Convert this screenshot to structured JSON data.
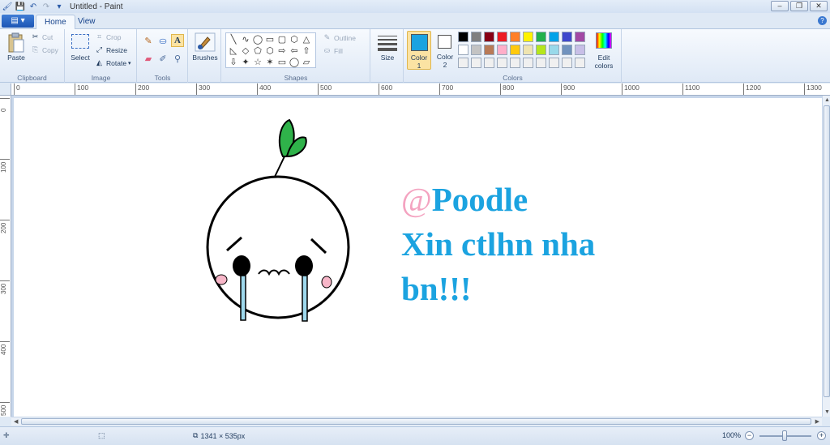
{
  "window": {
    "title": "Untitled - Paint",
    "minimize_label": "–",
    "restore_label": "❐",
    "close_label": "✕"
  },
  "tabs": {
    "file_label": "▤ ▾",
    "home": "Home",
    "view": "View",
    "help": "?"
  },
  "clipboard": {
    "group_label": "Clipboard",
    "paste": "Paste",
    "cut": "Cut",
    "copy": "Copy"
  },
  "image": {
    "group_label": "Image",
    "select": "Select",
    "crop": "Crop",
    "resize": "Resize",
    "rotate": "Rotate"
  },
  "tools": {
    "group_label": "Tools"
  },
  "brushes": {
    "label": "Brushes"
  },
  "shapes": {
    "group_label": "Shapes",
    "outline": "Outline",
    "fill": "Fill",
    "glyphs": [
      "╲",
      "∿",
      "◯",
      "▭",
      "▢",
      "⬡",
      "△",
      "◺",
      "◇",
      "⬠",
      "⬡",
      "⇨",
      "⇦",
      "⇧",
      "⇩",
      "✦",
      "☆",
      "✶",
      "▭",
      "◯",
      "▱"
    ]
  },
  "size": {
    "label": "Size"
  },
  "colors": {
    "group_label": "Colors",
    "color1_label": "Color",
    "color1_num": "1",
    "color2_label": "Color",
    "color2_num": "2",
    "color1": "#1ba3e0",
    "color2": "#ffffff",
    "edit_colors_1": "Edit",
    "edit_colors_2": "colors",
    "palette_row1": [
      "#000000",
      "#7f7f7f",
      "#880015",
      "#ed1c24",
      "#ff7f27",
      "#fff200",
      "#22b14c",
      "#00a2e8",
      "#3f48cc",
      "#a349a4"
    ],
    "palette_row2": [
      "#ffffff",
      "#c3c3c3",
      "#b97a57",
      "#ffaec9",
      "#ffc90e",
      "#efe4b0",
      "#b5e61d",
      "#99d9ea",
      "#7092be",
      "#c8bfe7"
    ],
    "palette_row3": [
      "#f0f0f0",
      "#f0f0f0",
      "#f0f0f0",
      "#f0f0f0",
      "#f0f0f0",
      "#f0f0f0",
      "#f0f0f0",
      "#f0f0f0",
      "#f0f0f0",
      "#f0f0f0"
    ]
  },
  "ruler": {
    "h_marks": [
      "0",
      "100",
      "200",
      "300",
      "400",
      "500",
      "600",
      "700",
      "800",
      "900",
      "1000",
      "1100",
      "1200",
      "1300"
    ],
    "v_marks": [
      "0",
      "100",
      "200",
      "300",
      "400",
      "500"
    ]
  },
  "canvas_text": {
    "at": "@",
    "line1": "Poodle",
    "line2": "Xin ctlhn nha",
    "line3": "bn!!!"
  },
  "status": {
    "image_size": "1341 × 535px",
    "zoom": "100%",
    "zoom_minus": "−",
    "zoom_plus": "+"
  }
}
